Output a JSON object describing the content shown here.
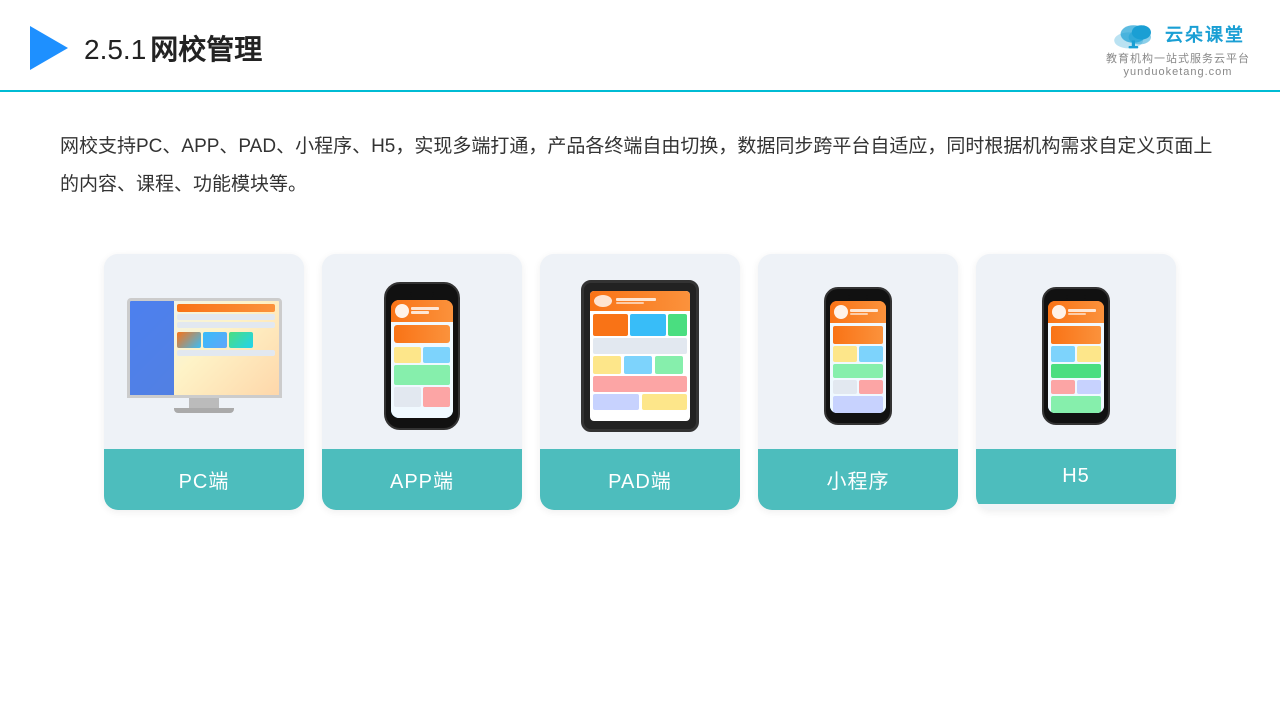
{
  "header": {
    "title": "网校管理",
    "number": "2.5.1",
    "logo_main": "云朵课堂",
    "logo_sub1": "教育机构一站",
    "logo_sub2": "式服务云平台",
    "logo_domain": "yunduoketang.com"
  },
  "description": "网校支持PC、APP、PAD、小程序、H5，实现多端打通，产品各终端自由切换，数据同步跨平台自适应，同时根据机构需求自定义页面上的内容、课程、功能模块等。",
  "cards": [
    {
      "id": "pc",
      "label": "PC端"
    },
    {
      "id": "app",
      "label": "APP端"
    },
    {
      "id": "pad",
      "label": "PAD端"
    },
    {
      "id": "miniprogram",
      "label": "小程序"
    },
    {
      "id": "h5",
      "label": "H5"
    }
  ],
  "accent_color": "#4dbdbd"
}
